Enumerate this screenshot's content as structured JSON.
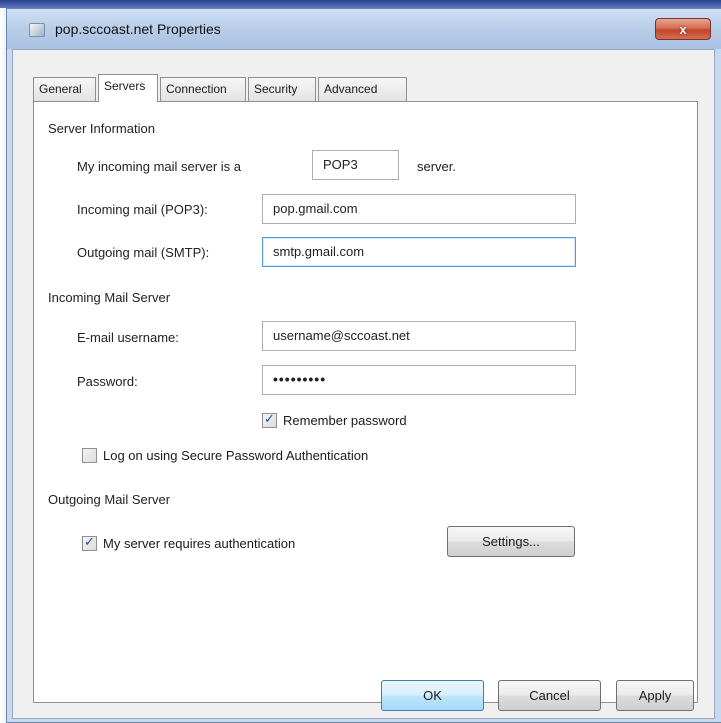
{
  "window": {
    "title": "pop.sccoast.net Properties",
    "close_symbol": "x"
  },
  "tabs": [
    {
      "label": "General",
      "active": false
    },
    {
      "label": "Servers",
      "active": true
    },
    {
      "label": "Connection",
      "active": false
    },
    {
      "label": "Security",
      "active": false
    },
    {
      "label": "Advanced",
      "active": false
    }
  ],
  "server_information": {
    "heading": "Server Information",
    "incoming_type_prefix": "My incoming mail server is a",
    "incoming_type_value": "POP3",
    "incoming_type_suffix": "server.",
    "incoming_label": "Incoming mail (POP3):",
    "incoming_value": "pop.gmail.com",
    "outgoing_label": "Outgoing mail (SMTP):",
    "outgoing_value": "smtp.gmail.com"
  },
  "incoming_mail_server": {
    "heading": "Incoming Mail Server",
    "username_label": "E-mail username:",
    "username_value": "username@sccoast.net",
    "password_label": "Password:",
    "password_value": "•••••••••",
    "remember_label": "Remember password",
    "remember_checked": true,
    "spa_label": "Log on using Secure Password Authentication",
    "spa_checked": false
  },
  "outgoing_mail_server": {
    "heading": "Outgoing Mail Server",
    "auth_label": "My server requires authentication",
    "auth_checked": true,
    "settings_label": "Settings..."
  },
  "buttons": {
    "ok": "OK",
    "cancel": "Cancel",
    "apply": "Apply"
  }
}
